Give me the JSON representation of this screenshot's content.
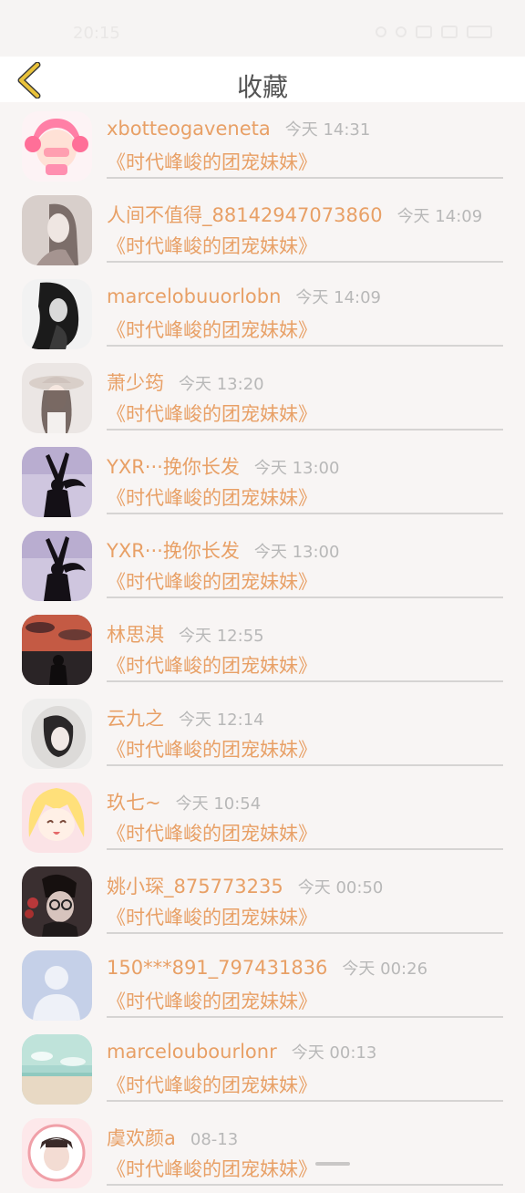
{
  "status_bar": {
    "time": "20:15"
  },
  "header": {
    "title": "收藏",
    "back_icon": "chevron-left-icon",
    "accent_color": "#e9c23a"
  },
  "colors": {
    "accent": "#e8a066",
    "meta": "#b8b8b8"
  },
  "items": [
    {
      "username": "xbotteogaveneta",
      "time": "今天 14:31",
      "title": "《时代峰峻的团宠妹妹》",
      "avatar": "anime-pink-hair-avatar"
    },
    {
      "username": "人间不值得_88142947073860",
      "time": "今天 14:09",
      "title": "《时代峰峻的团宠妹妹》",
      "avatar": "sepia-girl-avatar"
    },
    {
      "username": "marcelobuuorlobn",
      "time": "今天 14:09",
      "title": "《时代峰峻的团宠妹妹》",
      "avatar": "bw-woman-avatar"
    },
    {
      "username": "萧少筠",
      "time": "今天 13:20",
      "title": "《时代峰峻的团宠妹妹》",
      "avatar": "girl-hat-avatar"
    },
    {
      "username": "YXR···挽你长发",
      "time": "今天 13:00",
      "title": "《时代峰峻的团宠妹妹》",
      "avatar": "silhouette-purple-avatar"
    },
    {
      "username": "YXR···挽你长发",
      "time": "今天 13:00",
      "title": "《时代峰峻的团宠妹妹》",
      "avatar": "silhouette-purple-avatar"
    },
    {
      "username": "林思淇",
      "time": "今天 12:55",
      "title": "《时代峰峻的团宠妹妹》",
      "avatar": "sunset-silhouette-avatar"
    },
    {
      "username": "云九之",
      "time": "今天 12:14",
      "title": "《时代峰峻的团宠妹妹》",
      "avatar": "girl-pillow-avatar"
    },
    {
      "username": "玖七~",
      "time": "今天 10:54",
      "title": "《时代峰峻的团宠妹妹》",
      "avatar": "anime-blonde-avatar"
    },
    {
      "username": "姚小琛_875773235",
      "time": "今天 00:50",
      "title": "《时代峰峻的团宠妹妹》",
      "avatar": "boy-glasses-avatar"
    },
    {
      "username": "150***891_797431836",
      "time": "今天 00:26",
      "title": "《时代峰峻的团宠妹妹》",
      "avatar": "default-user-avatar"
    },
    {
      "username": "marceloubourlonr",
      "time": "今天 00:13",
      "title": "《时代峰峻的团宠妹妹》",
      "avatar": "beach-avatar"
    },
    {
      "username": "虞欢颜a",
      "time": "08-13",
      "title": "《时代峰峻的团宠妹妹》",
      "avatar": "boy-portrait-avatar"
    }
  ]
}
